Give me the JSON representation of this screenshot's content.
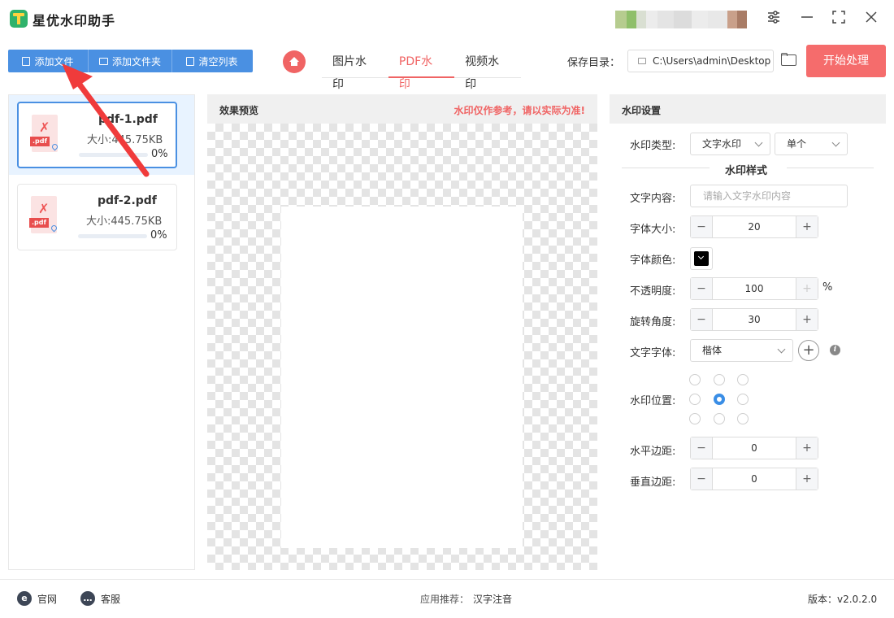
{
  "app": {
    "title": "星优水印助手"
  },
  "toolbar": {
    "add_file": "添加文件",
    "add_folder": "添加文件夹",
    "clear_list": "清空列表",
    "tabs": [
      {
        "label": "图片水印",
        "active": false
      },
      {
        "label": "PDF水印",
        "active": true
      },
      {
        "label": "视频水印",
        "active": false
      }
    ],
    "save_label": "保存目录：",
    "save_path": "C:\\Users\\admin\\Desktop",
    "start": "开始处理"
  },
  "files": [
    {
      "name": "pdf-1.pdf",
      "size": "大小:445.75KB",
      "progress": "0%",
      "pdf_tag": ".pdf",
      "selected": true
    },
    {
      "name": "pdf-2.pdf",
      "size": "大小:445.75KB",
      "progress": "0%",
      "pdf_tag": ".pdf",
      "selected": false
    }
  ],
  "preview": {
    "title": "效果预览",
    "note": "水印仅作参考，请以实际为准!"
  },
  "settings": {
    "title": "水印设置",
    "type_label": "水印类型:",
    "type_value": "文字水印",
    "mode_value": "单个",
    "section_title": "水印样式",
    "text_label": "文字内容:",
    "text_placeholder": "请输入文字水印内容",
    "size_label": "字体大小:",
    "size_value": "20",
    "color_label": "字体颜色:",
    "font_color": "#000000",
    "opacity_label": "不透明度:",
    "opacity_value": "100",
    "opacity_unit": "%",
    "rotation_label": "旋转角度:",
    "rotation_value": "30",
    "font_label": "文字字体:",
    "font_value": "楷体",
    "position_label": "水印位置:",
    "position_selected": "center",
    "hmargin_label": "水平边距:",
    "hmargin_value": "0",
    "vmargin_label": "垂直边距:",
    "vmargin_value": "0"
  },
  "footer": {
    "website": "官网",
    "service": "客服",
    "recommend_label": "应用推荐：",
    "recommend_app": "汉字注音",
    "version": "版本：v2.0.2.0"
  },
  "colors": {
    "accent_blue": "#4a90e2",
    "accent_red": "#f06464",
    "start_button": "#f56c6c"
  }
}
